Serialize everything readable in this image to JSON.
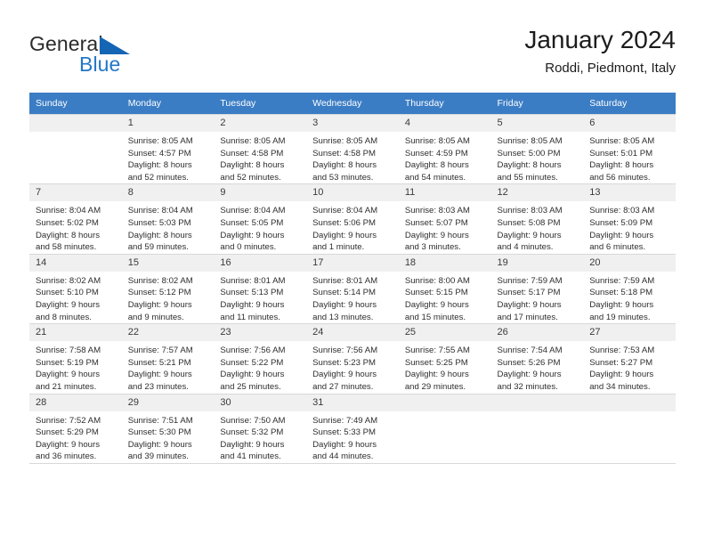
{
  "brand": {
    "word_general": "General",
    "word_blue": "Blue",
    "flag_icon": "triangle-flag-icon",
    "accent_color": "#1565b5",
    "blue_text_color": "#2277c8"
  },
  "header": {
    "title": "January 2024",
    "subtitle": "Roddi, Piedmont, Italy"
  },
  "calendar": {
    "header_bg": "#3b7dc4",
    "daynum_bg": "#f0f0f0",
    "weekdays": [
      "Sunday",
      "Monday",
      "Tuesday",
      "Wednesday",
      "Thursday",
      "Friday",
      "Saturday"
    ],
    "weeks": [
      [
        {
          "day": "",
          "empty": true,
          "sunrise": "",
          "sunset": "",
          "daylight_line1": "",
          "daylight_line2": ""
        },
        {
          "day": "1",
          "sunrise": "Sunrise: 8:05 AM",
          "sunset": "Sunset: 4:57 PM",
          "daylight_line1": "Daylight: 8 hours",
          "daylight_line2": "and 52 minutes."
        },
        {
          "day": "2",
          "sunrise": "Sunrise: 8:05 AM",
          "sunset": "Sunset: 4:58 PM",
          "daylight_line1": "Daylight: 8 hours",
          "daylight_line2": "and 52 minutes."
        },
        {
          "day": "3",
          "sunrise": "Sunrise: 8:05 AM",
          "sunset": "Sunset: 4:58 PM",
          "daylight_line1": "Daylight: 8 hours",
          "daylight_line2": "and 53 minutes."
        },
        {
          "day": "4",
          "sunrise": "Sunrise: 8:05 AM",
          "sunset": "Sunset: 4:59 PM",
          "daylight_line1": "Daylight: 8 hours",
          "daylight_line2": "and 54 minutes."
        },
        {
          "day": "5",
          "sunrise": "Sunrise: 8:05 AM",
          "sunset": "Sunset: 5:00 PM",
          "daylight_line1": "Daylight: 8 hours",
          "daylight_line2": "and 55 minutes."
        },
        {
          "day": "6",
          "sunrise": "Sunrise: 8:05 AM",
          "sunset": "Sunset: 5:01 PM",
          "daylight_line1": "Daylight: 8 hours",
          "daylight_line2": "and 56 minutes."
        }
      ],
      [
        {
          "day": "7",
          "sunrise": "Sunrise: 8:04 AM",
          "sunset": "Sunset: 5:02 PM",
          "daylight_line1": "Daylight: 8 hours",
          "daylight_line2": "and 58 minutes."
        },
        {
          "day": "8",
          "sunrise": "Sunrise: 8:04 AM",
          "sunset": "Sunset: 5:03 PM",
          "daylight_line1": "Daylight: 8 hours",
          "daylight_line2": "and 59 minutes."
        },
        {
          "day": "9",
          "sunrise": "Sunrise: 8:04 AM",
          "sunset": "Sunset: 5:05 PM",
          "daylight_line1": "Daylight: 9 hours",
          "daylight_line2": "and 0 minutes."
        },
        {
          "day": "10",
          "sunrise": "Sunrise: 8:04 AM",
          "sunset": "Sunset: 5:06 PM",
          "daylight_line1": "Daylight: 9 hours",
          "daylight_line2": "and 1 minute."
        },
        {
          "day": "11",
          "sunrise": "Sunrise: 8:03 AM",
          "sunset": "Sunset: 5:07 PM",
          "daylight_line1": "Daylight: 9 hours",
          "daylight_line2": "and 3 minutes."
        },
        {
          "day": "12",
          "sunrise": "Sunrise: 8:03 AM",
          "sunset": "Sunset: 5:08 PM",
          "daylight_line1": "Daylight: 9 hours",
          "daylight_line2": "and 4 minutes."
        },
        {
          "day": "13",
          "sunrise": "Sunrise: 8:03 AM",
          "sunset": "Sunset: 5:09 PM",
          "daylight_line1": "Daylight: 9 hours",
          "daylight_line2": "and 6 minutes."
        }
      ],
      [
        {
          "day": "14",
          "sunrise": "Sunrise: 8:02 AM",
          "sunset": "Sunset: 5:10 PM",
          "daylight_line1": "Daylight: 9 hours",
          "daylight_line2": "and 8 minutes."
        },
        {
          "day": "15",
          "sunrise": "Sunrise: 8:02 AM",
          "sunset": "Sunset: 5:12 PM",
          "daylight_line1": "Daylight: 9 hours",
          "daylight_line2": "and 9 minutes."
        },
        {
          "day": "16",
          "sunrise": "Sunrise: 8:01 AM",
          "sunset": "Sunset: 5:13 PM",
          "daylight_line1": "Daylight: 9 hours",
          "daylight_line2": "and 11 minutes."
        },
        {
          "day": "17",
          "sunrise": "Sunrise: 8:01 AM",
          "sunset": "Sunset: 5:14 PM",
          "daylight_line1": "Daylight: 9 hours",
          "daylight_line2": "and 13 minutes."
        },
        {
          "day": "18",
          "sunrise": "Sunrise: 8:00 AM",
          "sunset": "Sunset: 5:15 PM",
          "daylight_line1": "Daylight: 9 hours",
          "daylight_line2": "and 15 minutes."
        },
        {
          "day": "19",
          "sunrise": "Sunrise: 7:59 AM",
          "sunset": "Sunset: 5:17 PM",
          "daylight_line1": "Daylight: 9 hours",
          "daylight_line2": "and 17 minutes."
        },
        {
          "day": "20",
          "sunrise": "Sunrise: 7:59 AM",
          "sunset": "Sunset: 5:18 PM",
          "daylight_line1": "Daylight: 9 hours",
          "daylight_line2": "and 19 minutes."
        }
      ],
      [
        {
          "day": "21",
          "sunrise": "Sunrise: 7:58 AM",
          "sunset": "Sunset: 5:19 PM",
          "daylight_line1": "Daylight: 9 hours",
          "daylight_line2": "and 21 minutes."
        },
        {
          "day": "22",
          "sunrise": "Sunrise: 7:57 AM",
          "sunset": "Sunset: 5:21 PM",
          "daylight_line1": "Daylight: 9 hours",
          "daylight_line2": "and 23 minutes."
        },
        {
          "day": "23",
          "sunrise": "Sunrise: 7:56 AM",
          "sunset": "Sunset: 5:22 PM",
          "daylight_line1": "Daylight: 9 hours",
          "daylight_line2": "and 25 minutes."
        },
        {
          "day": "24",
          "sunrise": "Sunrise: 7:56 AM",
          "sunset": "Sunset: 5:23 PM",
          "daylight_line1": "Daylight: 9 hours",
          "daylight_line2": "and 27 minutes."
        },
        {
          "day": "25",
          "sunrise": "Sunrise: 7:55 AM",
          "sunset": "Sunset: 5:25 PM",
          "daylight_line1": "Daylight: 9 hours",
          "daylight_line2": "and 29 minutes."
        },
        {
          "day": "26",
          "sunrise": "Sunrise: 7:54 AM",
          "sunset": "Sunset: 5:26 PM",
          "daylight_line1": "Daylight: 9 hours",
          "daylight_line2": "and 32 minutes."
        },
        {
          "day": "27",
          "sunrise": "Sunrise: 7:53 AM",
          "sunset": "Sunset: 5:27 PM",
          "daylight_line1": "Daylight: 9 hours",
          "daylight_line2": "and 34 minutes."
        }
      ],
      [
        {
          "day": "28",
          "sunrise": "Sunrise: 7:52 AM",
          "sunset": "Sunset: 5:29 PM",
          "daylight_line1": "Daylight: 9 hours",
          "daylight_line2": "and 36 minutes."
        },
        {
          "day": "29",
          "sunrise": "Sunrise: 7:51 AM",
          "sunset": "Sunset: 5:30 PM",
          "daylight_line1": "Daylight: 9 hours",
          "daylight_line2": "and 39 minutes."
        },
        {
          "day": "30",
          "sunrise": "Sunrise: 7:50 AM",
          "sunset": "Sunset: 5:32 PM",
          "daylight_line1": "Daylight: 9 hours",
          "daylight_line2": "and 41 minutes."
        },
        {
          "day": "31",
          "sunrise": "Sunrise: 7:49 AM",
          "sunset": "Sunset: 5:33 PM",
          "daylight_line1": "Daylight: 9 hours",
          "daylight_line2": "and 44 minutes."
        },
        {
          "day": "",
          "empty": true,
          "sunrise": "",
          "sunset": "",
          "daylight_line1": "",
          "daylight_line2": ""
        },
        {
          "day": "",
          "empty": true,
          "sunrise": "",
          "sunset": "",
          "daylight_line1": "",
          "daylight_line2": ""
        },
        {
          "day": "",
          "empty": true,
          "sunrise": "",
          "sunset": "",
          "daylight_line1": "",
          "daylight_line2": ""
        }
      ]
    ]
  }
}
